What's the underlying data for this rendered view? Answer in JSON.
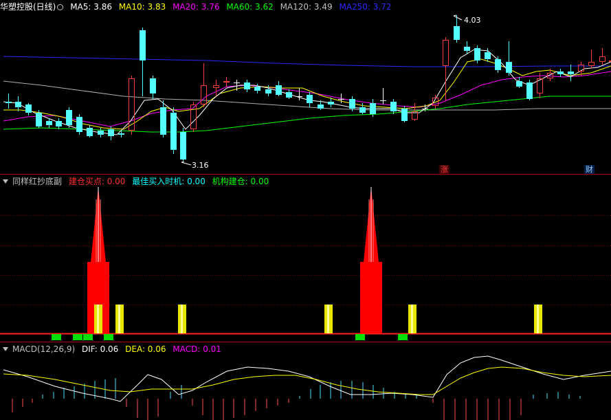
{
  "main_panel": {
    "title": "华塑控股(日线)",
    "ma_labels": [
      {
        "label": "MA5: 3.86",
        "color": "#ffffff"
      },
      {
        "label": "MA10: 3.83",
        "color": "#ffff00"
      },
      {
        "label": "MA20: 3.76",
        "color": "#ff00ff"
      },
      {
        "label": "MA60: 3.62",
        "color": "#00ff00"
      },
      {
        "label": "MA120: 3.49",
        "color": "#c0c0c0"
      },
      {
        "label": "MA250: 3.72",
        "color": "#0000ff"
      }
    ],
    "high_label": "4.03",
    "low_label": "3.16",
    "badge_rise": "涨",
    "badge_fin": "财"
  },
  "indicator_panel": {
    "name": "同样红抄底副",
    "items": [
      {
        "label": "建仓买点: 0.00",
        "color": "#ff3030"
      },
      {
        "label": "最佳买入时机: 0.00",
        "color": "#00ffff"
      },
      {
        "label": "机构建仓: 0.00",
        "color": "#00ff00"
      }
    ]
  },
  "macd_panel": {
    "name": "MACD(12,26,9)",
    "items": [
      {
        "label": "DIF: 0.06",
        "color": "#ffffff"
      },
      {
        "label": "DEA: 0.06",
        "color": "#ffff00"
      },
      {
        "label": "MACD: 0.01",
        "color": "#ff00ff"
      }
    ]
  },
  "colors": {
    "up": "#ff3c3c",
    "down": "#54ffff",
    "grid": "#7a0000",
    "border": "#b00000"
  }
}
